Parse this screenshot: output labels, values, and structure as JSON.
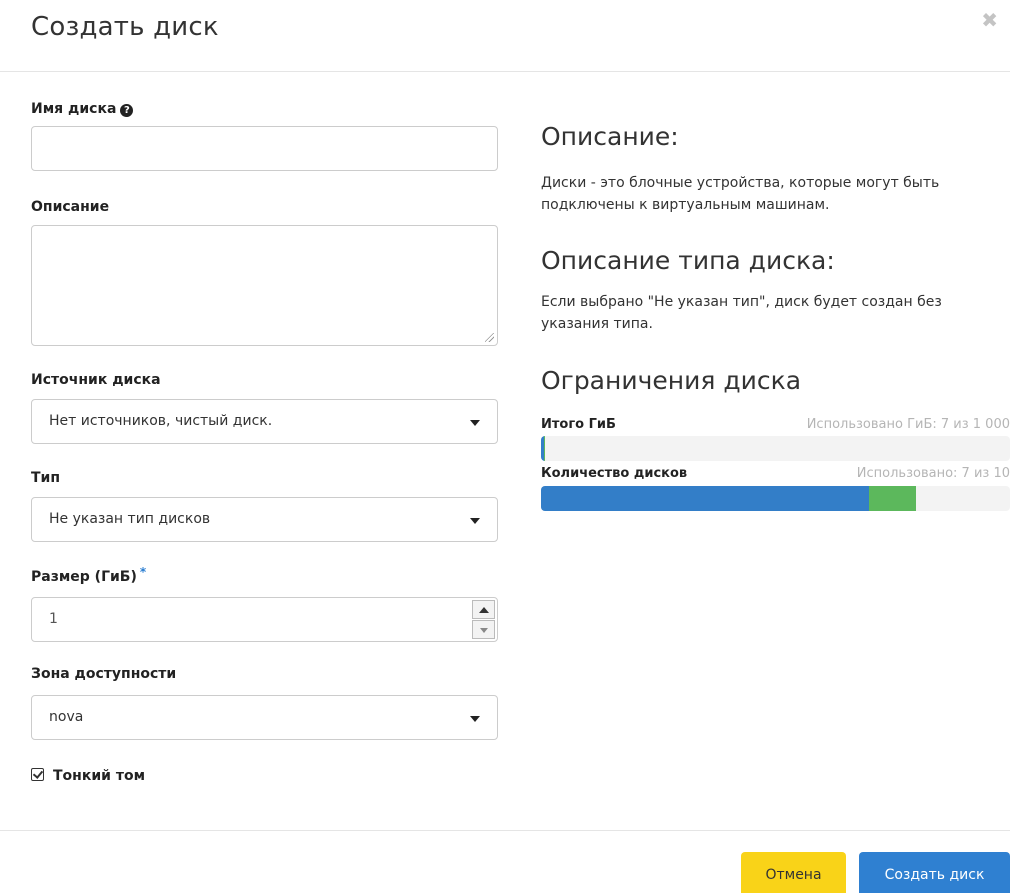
{
  "dialog": {
    "title": "Создать диск",
    "close_icon": "close-icon"
  },
  "form": {
    "name": {
      "label": "Имя диска",
      "value": "",
      "help_icon": "question-circle-icon"
    },
    "description": {
      "label": "Описание",
      "value": ""
    },
    "source": {
      "label": "Источник диска",
      "selected": "Нет источников, чистый диск."
    },
    "type": {
      "label": "Тип",
      "selected": "Не указан тип дисков"
    },
    "size": {
      "label": "Размер (ГиБ)",
      "required_mark": "*",
      "value": "1"
    },
    "availability_zone": {
      "label": "Зона доступности",
      "selected": "nova"
    },
    "thin_volume": {
      "label": "Тонкий том",
      "checked": true
    }
  },
  "info": {
    "description_heading": "Описание:",
    "description_text": "Диски - это блочные устройства, которые могут быть подключены к виртуальным машинам.",
    "type_heading": "Описание типа диска:",
    "type_text": "Если выбрано \"Не указан тип\", диск будет создан без указания типа.",
    "limits_heading": "Ограничения диска"
  },
  "quotas": [
    {
      "label": "Итого ГиБ",
      "used_text": "Использовано ГиБ: 7 из 1 000",
      "used": 7,
      "total": 1000,
      "added": 1
    },
    {
      "label": "Количество дисков",
      "used_text": "Использовано: 7 из 10",
      "used": 7,
      "total": 10,
      "added": 1
    }
  ],
  "colors": {
    "used": "#337ec8",
    "added": "#5cb85c",
    "cancel": "#f9d318",
    "primary": "#2f80d1"
  },
  "footer": {
    "cancel_label": "Отмена",
    "submit_label": "Создать диск"
  }
}
